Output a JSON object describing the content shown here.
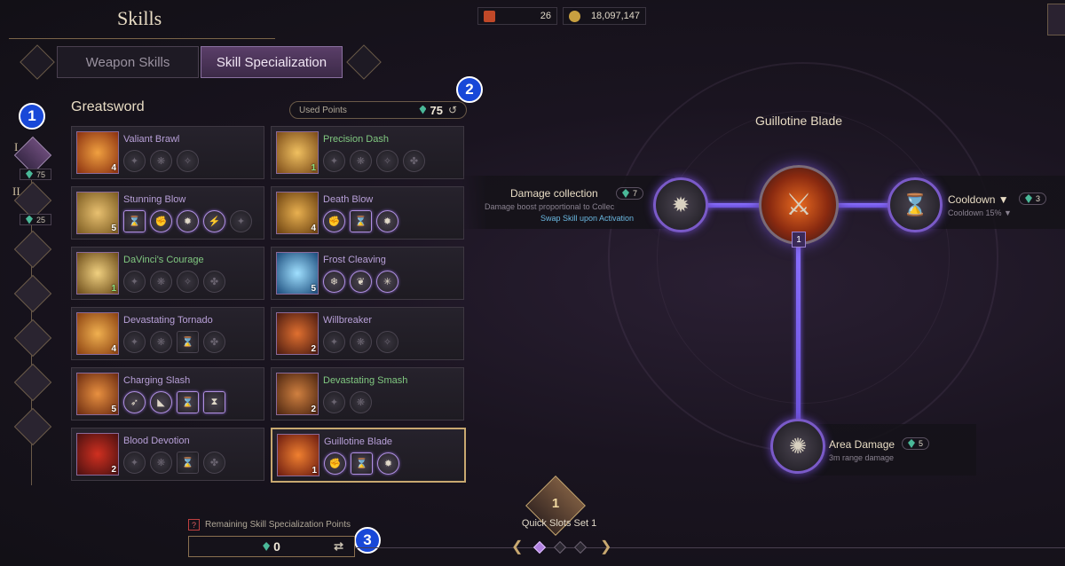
{
  "header": {
    "title": "Skills",
    "currency": [
      {
        "icon": "ticket-icon",
        "value": "26"
      },
      {
        "icon": "coin-icon",
        "value": "18,097,147"
      }
    ]
  },
  "tabs": [
    {
      "label": "Weapon Skills",
      "active": false
    },
    {
      "label": "Skill Specialization",
      "active": true
    }
  ],
  "badges": [
    "1",
    "2",
    "3"
  ],
  "weapon": {
    "name": "Greatsword"
  },
  "used_points": {
    "label": "Used Points",
    "value": "75"
  },
  "tiers": [
    {
      "label": "I",
      "points": "75"
    },
    {
      "label": "II",
      "points": "25"
    }
  ],
  "skills_left": [
    {
      "name": "Valiant Brawl",
      "level": "4",
      "level_green": false,
      "name_green": false
    },
    {
      "name": "Stunning Blow",
      "level": "5",
      "level_green": false,
      "name_green": false
    },
    {
      "name": "DaVinci's Courage",
      "level": "1",
      "level_green": true,
      "name_green": true
    },
    {
      "name": "Devastating Tornado",
      "level": "4",
      "level_green": false,
      "name_green": false
    },
    {
      "name": "Charging Slash",
      "level": "5",
      "level_green": false,
      "name_green": false
    },
    {
      "name": "Blood Devotion",
      "level": "2",
      "level_green": false,
      "name_green": false
    }
  ],
  "skills_right": [
    {
      "name": "Precision Dash",
      "level": "1",
      "level_green": true,
      "name_green": true
    },
    {
      "name": "Death Blow",
      "level": "4",
      "level_green": false,
      "name_green": false
    },
    {
      "name": "Frost Cleaving",
      "level": "5",
      "level_green": false,
      "name_green": false
    },
    {
      "name": "Willbreaker",
      "level": "2",
      "level_green": false,
      "name_green": false
    },
    {
      "name": "Devastating Smash",
      "level": "2",
      "level_green": false,
      "name_green": true
    },
    {
      "name": "Guillotine Blade",
      "level": "1",
      "level_green": false,
      "name_green": false
    }
  ],
  "tree": {
    "title": "Guillotine Blade",
    "main_level": "1",
    "left": {
      "name": "Damage collection",
      "points": "7",
      "desc": "Damage boost proportional to Collec",
      "swap": "Swap Skill upon Activation"
    },
    "right": {
      "name": "Cooldown ▼",
      "points": "3",
      "desc": "Cooldown 15% ▼"
    },
    "bottom": {
      "name": "Area Damage",
      "points": "5",
      "desc": "3m range damage"
    }
  },
  "remaining": {
    "label": "Remaining Skill Specialization Points",
    "help": "?",
    "value": "0"
  },
  "quick_slots": {
    "number": "1",
    "label": "Quick Slots Set 1"
  }
}
